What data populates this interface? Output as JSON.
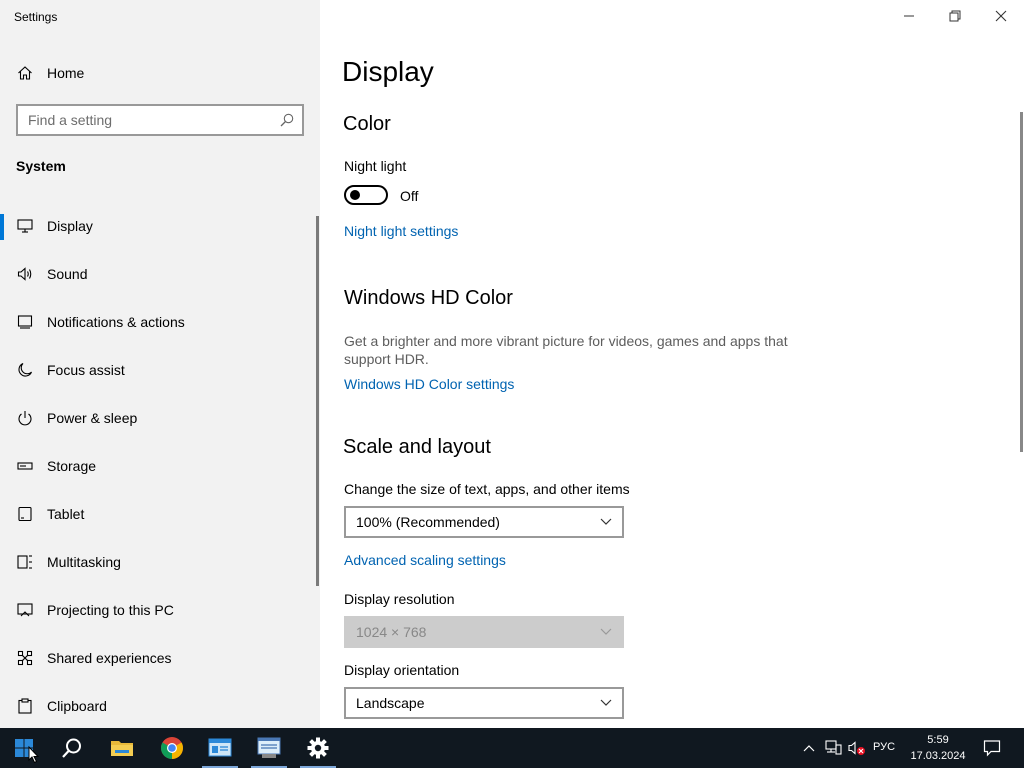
{
  "window": {
    "title": "Settings"
  },
  "sidebar": {
    "home_label": "Home",
    "search_placeholder": "Find a setting",
    "section_title": "System",
    "items": [
      {
        "label": "Display",
        "icon": "monitor-icon",
        "active": true
      },
      {
        "label": "Sound",
        "icon": "speaker-icon"
      },
      {
        "label": "Notifications & actions",
        "icon": "notification-icon"
      },
      {
        "label": "Focus assist",
        "icon": "moon-icon"
      },
      {
        "label": "Power & sleep",
        "icon": "power-icon"
      },
      {
        "label": "Storage",
        "icon": "storage-icon"
      },
      {
        "label": "Tablet",
        "icon": "tablet-icon"
      },
      {
        "label": "Multitasking",
        "icon": "multitasking-icon"
      },
      {
        "label": "Projecting to this PC",
        "icon": "projecting-icon"
      },
      {
        "label": "Shared experiences",
        "icon": "shared-experiences-icon"
      },
      {
        "label": "Clipboard",
        "icon": "clipboard-icon"
      }
    ]
  },
  "main": {
    "title": "Display",
    "color": {
      "heading": "Color",
      "night_light_label": "Night light",
      "night_light_state": "Off",
      "night_light_link": "Night light settings"
    },
    "hd_color": {
      "heading": "Windows HD Color",
      "description": "Get a brighter and more vibrant picture for videos, games and apps that support HDR.",
      "link": "Windows HD Color settings"
    },
    "scale_layout": {
      "heading": "Scale and layout",
      "scale_label": "Change the size of text, apps, and other items",
      "scale_value": "100% (Recommended)",
      "advanced_link": "Advanced scaling settings",
      "resolution_label": "Display resolution",
      "resolution_value": "1024 × 768",
      "orientation_label": "Display orientation",
      "orientation_value": "Landscape"
    }
  },
  "taskbar": {
    "language": "РУС",
    "time": "5:59",
    "date": "17.03.2024"
  },
  "colors": {
    "accent": "#0078d7",
    "link": "#0063b1",
    "sidebar_bg": "#f2f2f2",
    "taskbar_bg": "#101820"
  }
}
